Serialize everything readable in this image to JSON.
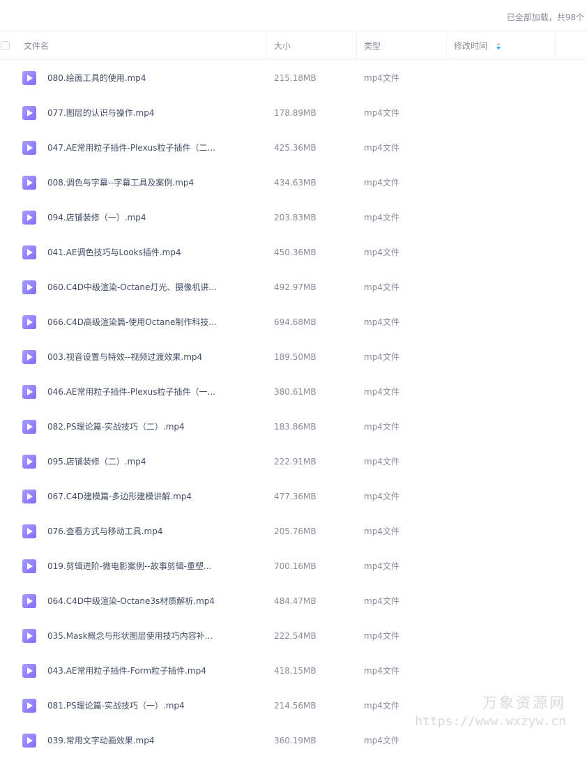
{
  "status": "已全部加载，共98个",
  "header": {
    "name": "文件名",
    "size": "大小",
    "type": "类型",
    "modified": "修改时间"
  },
  "files": [
    {
      "name": "080.绘画工具的使用.mp4",
      "size": "215.18MB",
      "type": "mp4文件",
      "icon": "video-file-icon"
    },
    {
      "name": "077.图层的认识与操作.mp4",
      "size": "178.89MB",
      "type": "mp4文件",
      "icon": "video-file-icon"
    },
    {
      "name": "047.AE常用粒子插件-Plexus粒子插件（二...",
      "size": "425.36MB",
      "type": "mp4文件",
      "icon": "video-file-icon"
    },
    {
      "name": "008.调色与字幕--字幕工具及案例.mp4",
      "size": "434.63MB",
      "type": "mp4文件",
      "icon": "video-file-icon"
    },
    {
      "name": "094.店铺装修（一）.mp4",
      "size": "203.83MB",
      "type": "mp4文件",
      "icon": "video-file-icon"
    },
    {
      "name": "041.AE调色技巧与Looks插件.mp4",
      "size": "450.36MB",
      "type": "mp4文件",
      "icon": "video-file-icon"
    },
    {
      "name": "060.C4D中级渲染-Octane灯光、摄像机讲...",
      "size": "492.97MB",
      "type": "mp4文件",
      "icon": "video-file-icon"
    },
    {
      "name": "066.C4D高级渲染篇-使用Octane制作科技...",
      "size": "694.68MB",
      "type": "mp4文件",
      "icon": "video-file-icon"
    },
    {
      "name": "003.视音设置与特效--视频过渡效果.mp4",
      "size": "189.50MB",
      "type": "mp4文件",
      "icon": "video-file-icon"
    },
    {
      "name": "046.AE常用粒子插件-Plexus粒子插件（一...",
      "size": "380.61MB",
      "type": "mp4文件",
      "icon": "video-file-icon"
    },
    {
      "name": "082.PS理论篇-实战技巧（二）.mp4",
      "size": "183.86MB",
      "type": "mp4文件",
      "icon": "video-file-icon"
    },
    {
      "name": "095.店铺装修（二）.mp4",
      "size": "222.91MB",
      "type": "mp4文件",
      "icon": "video-file-icon"
    },
    {
      "name": "067.C4D建模篇-多边形建模讲解.mp4",
      "size": "477.36MB",
      "type": "mp4文件",
      "icon": "video-file-icon"
    },
    {
      "name": "076.查看方式与移动工具.mp4",
      "size": "205.76MB",
      "type": "mp4文件",
      "icon": "video-file-icon"
    },
    {
      "name": "019.剪辑进阶-微电影案例--故事剪辑-重塑...",
      "size": "700.16MB",
      "type": "mp4文件",
      "icon": "video-file-icon"
    },
    {
      "name": "064.C4D中级渲染-Octane3s材质解析.mp4",
      "size": "484.47MB",
      "type": "mp4文件",
      "icon": "video-file-icon"
    },
    {
      "name": "035.Mask概念与形状图层使用技巧内容补...",
      "size": "222.54MB",
      "type": "mp4文件",
      "icon": "video-file-icon"
    },
    {
      "name": "043.AE常用粒子插件-Form粒子插件.mp4",
      "size": "418.15MB",
      "type": "mp4文件",
      "icon": "video-file-icon"
    },
    {
      "name": "081.PS理论篇-实战技巧（一）.mp4",
      "size": "214.56MB",
      "type": "mp4文件",
      "icon": "video-file-icon"
    },
    {
      "name": "039.常用文字动画效果.mp4",
      "size": "360.19MB",
      "type": "mp4文件",
      "icon": "video-file-icon"
    }
  ],
  "watermark": {
    "title": "万象资源网",
    "url": "https://www.wxzyw.cn"
  },
  "colors": {
    "icon_accent": "#8b7cf8",
    "sort_accent": "#06a7ff",
    "text_primary": "#424e67",
    "text_secondary": "#878c9c"
  }
}
